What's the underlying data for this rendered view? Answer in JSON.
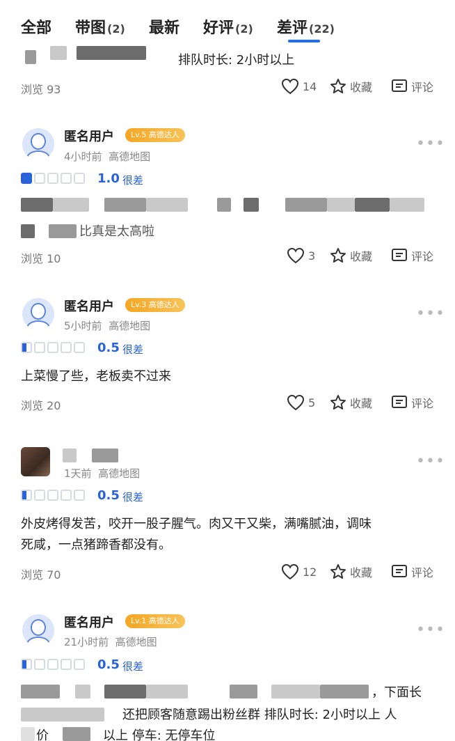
{
  "tabs": [
    {
      "label": "全部",
      "count": ""
    },
    {
      "label": "带图",
      "count": "(2)"
    },
    {
      "label": "最新",
      "count": ""
    },
    {
      "label": "好评",
      "count": "(2)"
    },
    {
      "label": "差评",
      "count": "(22)"
    }
  ],
  "active_tab_color": "#1d6ff2",
  "rating_color": "#2a62d8",
  "review0": {
    "text": "排队时长: 2小时以上",
    "views": "浏览 93",
    "likes": "14",
    "favorite_label": "收藏",
    "comment_label": "评论"
  },
  "review1": {
    "user": "匿名用户",
    "level": "Lv.5 高德达人",
    "time": "4小时前",
    "source": "高德地图",
    "score": "1.0",
    "rating": 1.0,
    "score_label": "很差",
    "text_partial": "比真是太高啦",
    "views": "浏览 10",
    "likes": "3",
    "favorite_label": "收藏",
    "comment_label": "评论"
  },
  "review2": {
    "user": "匿名用户",
    "level": "Lv.3 高德达人",
    "time": "5小时前",
    "source": "高德地图",
    "score": "0.5",
    "rating": 0.5,
    "score_label": "很差",
    "text": "上菜慢了些，老板卖不过来",
    "views": "浏览 20",
    "likes": "5",
    "favorite_label": "收藏",
    "comment_label": "评论"
  },
  "review3": {
    "time": "1天前",
    "source": "高德地图",
    "score": "0.5",
    "rating": 0.5,
    "score_label": "很差",
    "text_line1": "外皮烤得发苦，咬开一股子腥气。肉又干又柴，满嘴腻油，调味",
    "text_line2": "死咸，一点猪蹄香都没有。",
    "views": "浏览 70",
    "likes": "12",
    "favorite_label": "收藏",
    "comment_label": "评论"
  },
  "review4": {
    "user": "匿名用户",
    "level": "Lv.1 高德达人",
    "time": "21小时前",
    "source": "高德地图",
    "score": "0.5",
    "rating": 0.5,
    "score_label": "很差",
    "text_line1_tail": "，下面长",
    "text_line2": "还把顾客随意踢出粉丝群 排队时长: 2小时以上 人",
    "text_line3_a": "价",
    "text_line3_b": "以上 停车: 无停车位"
  },
  "icons": {
    "like": "heart-icon",
    "favorite": "star-icon",
    "comment": "comment-icon",
    "more": "more-dots-icon"
  }
}
